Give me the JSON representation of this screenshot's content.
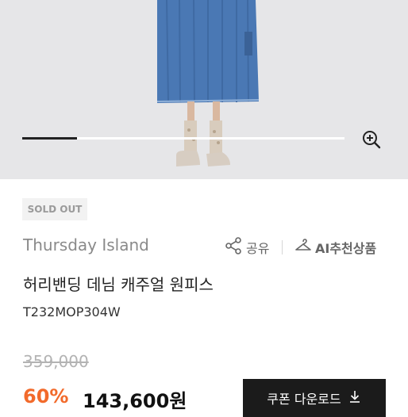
{
  "gallery": {
    "progress_fraction": 0.17,
    "zoom_icon": "zoom-in-icon"
  },
  "product": {
    "badge": "SOLD OUT",
    "brand": "Thursday Island",
    "share_label": "공유",
    "ai_label": "AI추천상품",
    "title": "허리밴딩 데님 캐주얼 원피스",
    "code": "T232MOP304W",
    "original_price": "359,000",
    "discount": "60%",
    "price": "143,600원",
    "coupon_label": "쿠폰 다운로드"
  },
  "colors": {
    "discount": "#f26a2b",
    "button_bg": "#1b1b1b",
    "denim": "#4a78b4"
  }
}
